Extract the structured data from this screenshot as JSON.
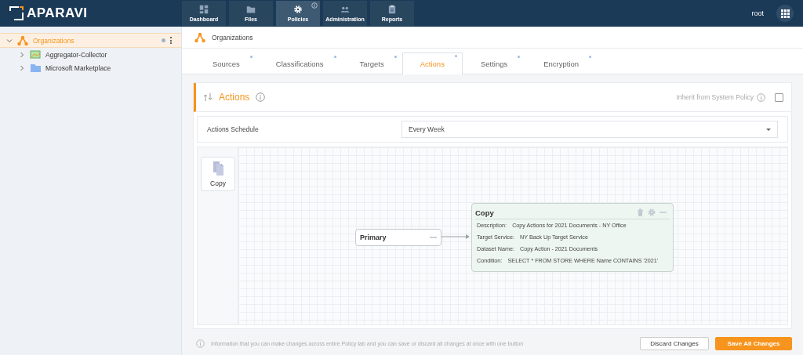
{
  "app": {
    "logo": "APARAVI",
    "user": "root"
  },
  "nav": [
    {
      "label": "Dashboard",
      "kind": "dashboard",
      "selected": false,
      "info_badge": false
    },
    {
      "label": "Files",
      "kind": "folder",
      "selected": false,
      "info_badge": false
    },
    {
      "label": "Policies",
      "kind": "gear",
      "selected": true,
      "info_badge": true
    },
    {
      "label": "Administration",
      "kind": "people",
      "selected": false,
      "info_badge": false
    },
    {
      "label": "Reports",
      "kind": "clipboard",
      "selected": false,
      "info_badge": false
    }
  ],
  "sidebar": {
    "items": [
      {
        "label": "Organizations",
        "kind": "org",
        "expanded": true,
        "selected": true,
        "children": [
          {
            "label": "Aggregator-Collector",
            "kind": "collector",
            "expanded": false,
            "selected": false
          },
          {
            "label": "Microsoft Marketplace",
            "kind": "folder",
            "expanded": false,
            "selected": false
          }
        ]
      }
    ]
  },
  "breadcrumb": "Organizations",
  "tabs": [
    {
      "label": "Sources",
      "selected": false
    },
    {
      "label": "Classifications",
      "selected": false
    },
    {
      "label": "Targets",
      "selected": false
    },
    {
      "label": "Actions",
      "selected": true
    },
    {
      "label": "Settings",
      "selected": false
    },
    {
      "label": "Encryption",
      "selected": false
    }
  ],
  "panel": {
    "title": "Actions",
    "inherit": {
      "label": "Inherit from System Policy",
      "checked": false
    },
    "schedule": {
      "label": "Actions Schedule",
      "value": "Every Week"
    },
    "palette": [
      {
        "label": "Copy"
      }
    ],
    "source_node": {
      "label": "Primary"
    },
    "action_node": {
      "title": "Copy",
      "fields": [
        {
          "label": "Description:",
          "value": "Copy Actions for 2021 Documents - NY Office"
        },
        {
          "label": "Target Service:",
          "value": "NY Back Up Target Service"
        },
        {
          "label": "Dataset Name:",
          "value": "Copy Action - 2021 Documents"
        },
        {
          "label": "Condition:",
          "value": "SELECT * FROM STORE WHERE Name CONTAINS '2021'"
        }
      ]
    }
  },
  "footer": {
    "info": "Information that you can make changes across entire Policy tab and you can save or discard all changes at once with one button",
    "buttons": [
      {
        "label": "Discard Changes",
        "kind": "secondary"
      },
      {
        "label": "Save All Changes",
        "kind": "primary"
      }
    ]
  }
}
